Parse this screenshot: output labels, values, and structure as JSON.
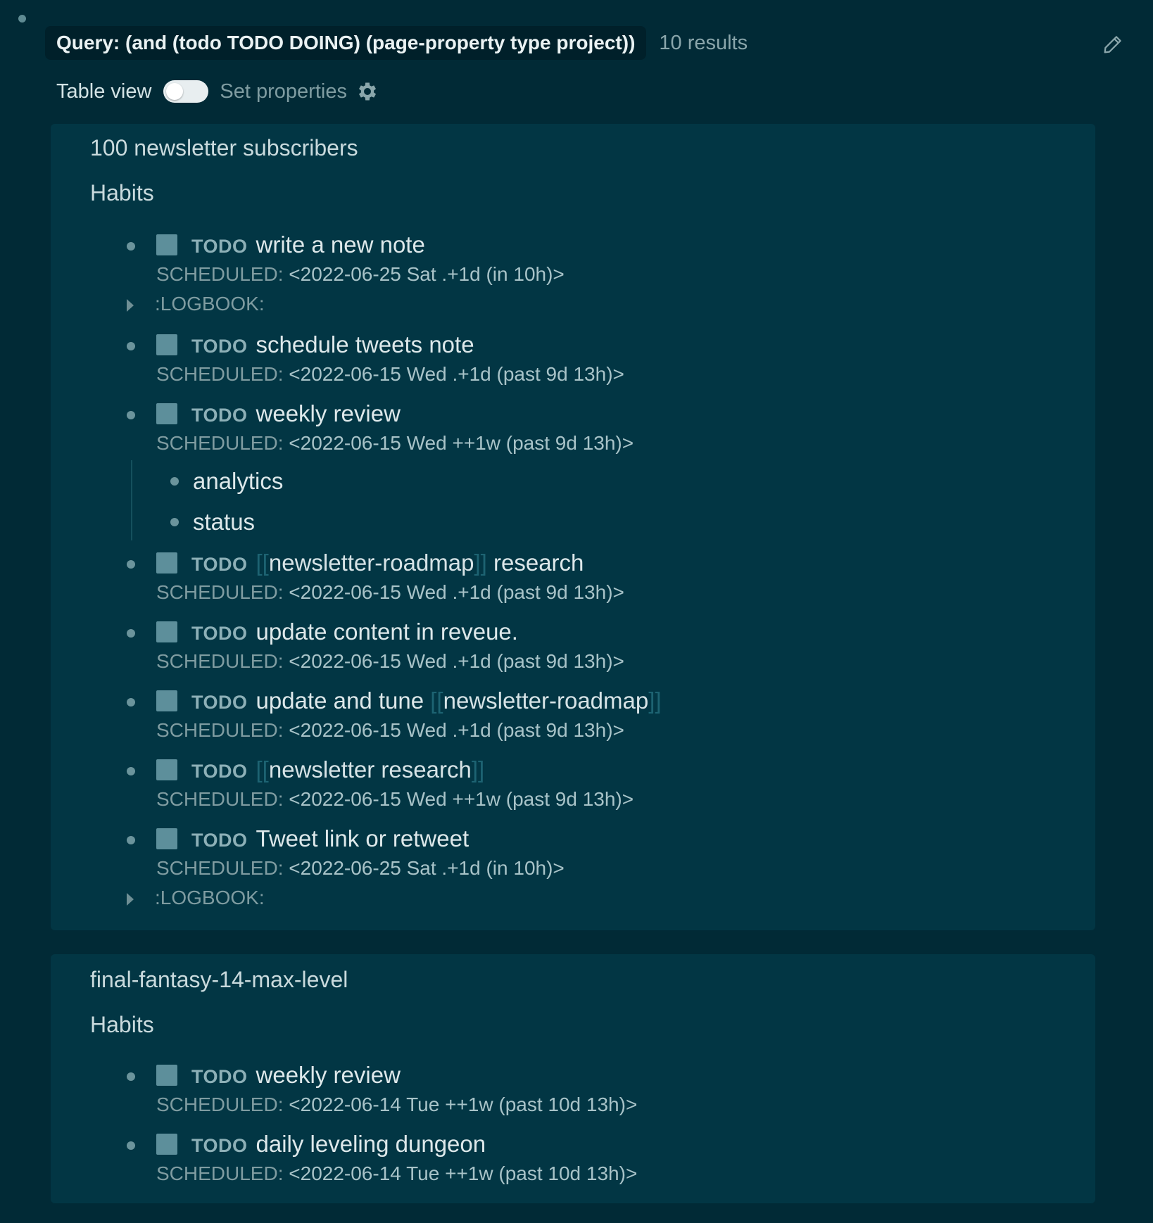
{
  "query": {
    "label": "Query: (and (todo TODO DOING) (page-property type project))",
    "results": "10 results",
    "edit_icon": "pencil-icon"
  },
  "controls": {
    "table_view_label": "Table view",
    "table_view_on": false,
    "set_properties_label": "Set properties",
    "settings_icon": "gear-icon"
  },
  "groups": [
    {
      "title": "100 newsletter subscribers",
      "section": "Habits",
      "items": [
        {
          "marker": "TODO",
          "text": "write a new note",
          "sched_key": "SCHEDULED:",
          "sched_val": "<2022-06-25 Sat .+1d (in 10h)>",
          "logbook": ":LOGBOOK:"
        },
        {
          "marker": "TODO",
          "text": "schedule tweets note",
          "sched_key": "SCHEDULED:",
          "sched_val": "<2022-06-15 Wed .+1d (past 9d 13h)>"
        },
        {
          "marker": "TODO",
          "text": "weekly review",
          "sched_key": "SCHEDULED:",
          "sched_val": "<2022-06-15 Wed ++1w (past 9d 13h)>",
          "children": [
            "analytics",
            "status"
          ]
        },
        {
          "marker": "TODO",
          "ref_open": "[[",
          "ref": "newsletter-roadmap",
          "ref_close": "]]",
          "text_after": " research",
          "sched_key": "SCHEDULED:",
          "sched_val": "<2022-06-15 Wed .+1d (past 9d 13h)>"
        },
        {
          "marker": "TODO",
          "text": "update content in reveue.",
          "sched_key": "SCHEDULED:",
          "sched_val": "<2022-06-15 Wed .+1d (past 9d 13h)>"
        },
        {
          "marker": "TODO",
          "text_before": "update and tune ",
          "ref_open": "[[",
          "ref": "newsletter-roadmap",
          "ref_close": "]]",
          "sched_key": "SCHEDULED:",
          "sched_val": "<2022-06-15 Wed .+1d (past 9d 13h)>"
        },
        {
          "marker": "TODO",
          "ref_open": "[[",
          "ref": "newsletter research",
          "ref_close": "]]",
          "sched_key": "SCHEDULED:",
          "sched_val": "<2022-06-15 Wed ++1w (past 9d 13h)>"
        },
        {
          "marker": "TODO",
          "text": "Tweet link or retweet",
          "sched_key": "SCHEDULED:",
          "sched_val": "<2022-06-25 Sat .+1d (in 10h)>",
          "logbook": ":LOGBOOK:"
        }
      ]
    },
    {
      "title": "final-fantasy-14-max-level",
      "section": "Habits",
      "items": [
        {
          "marker": "TODO",
          "text": "weekly review",
          "sched_key": "SCHEDULED:",
          "sched_val": "<2022-06-14 Tue ++1w (past 10d 13h)>"
        },
        {
          "marker": "TODO",
          "text": "daily leveling dungeon",
          "sched_key": "SCHEDULED:",
          "sched_val": "<2022-06-14 Tue ++1w (past 10d 13h)>"
        }
      ]
    }
  ],
  "colors": {
    "background": "#012a36",
    "card": "#023644",
    "checkbox": "#5d8f9b",
    "link_bracket": "#1d6372"
  }
}
